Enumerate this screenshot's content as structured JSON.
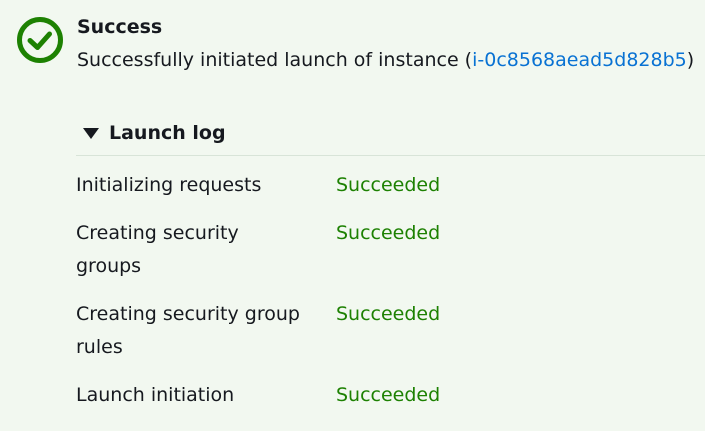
{
  "alert": {
    "type": "success",
    "icon": "success-check-circle-icon",
    "title": "Success",
    "message_prefix": "Successfully initiated launch of instance (",
    "instance_id": "i-0c8568aead5d828b5",
    "message_suffix": ")"
  },
  "launch_log": {
    "toggle_label": "Launch log",
    "expanded": true,
    "steps": [
      {
        "name": "Initializing requests",
        "status": "Succeeded"
      },
      {
        "name": "Creating security groups",
        "status": "Succeeded"
      },
      {
        "name": "Creating security group rules",
        "status": "Succeeded"
      },
      {
        "name": "Launch initiation",
        "status": "Succeeded"
      }
    ]
  },
  "colors": {
    "background": "#f2f8f0",
    "success": "#1d8102",
    "link": "#0972d3",
    "text": "#16191f"
  }
}
